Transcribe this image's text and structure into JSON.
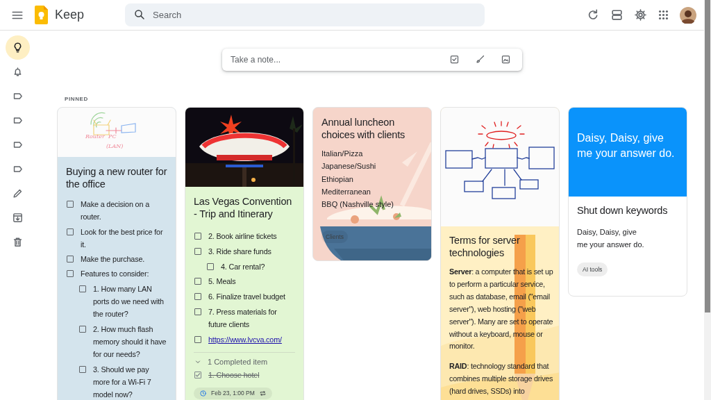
{
  "topbar": {
    "app_name": "Keep",
    "search": {
      "placeholder": "Search"
    }
  },
  "sidebar": [
    {
      "kind": "notes",
      "selected": true
    },
    {
      "kind": "reminders",
      "selected": false
    },
    {
      "kind": "label",
      "selected": false
    },
    {
      "kind": "label",
      "selected": false
    },
    {
      "kind": "label",
      "selected": false
    },
    {
      "kind": "label",
      "selected": false
    },
    {
      "kind": "edit",
      "selected": false
    },
    {
      "kind": "archive",
      "selected": false
    },
    {
      "kind": "trash",
      "selected": false
    }
  ],
  "new_note": {
    "placeholder": "Take a note..."
  },
  "section_title": "PINNED",
  "notes": [
    {
      "color": "#d4e4ed",
      "header": {
        "kind": "router-sketch",
        "labels": [
          "Router",
          "PC",
          "(LAN)"
        ]
      },
      "title": "Buying a new router for the office",
      "kind": "checklist",
      "items": [
        {
          "text": "Make a decision on a router.",
          "checked": false
        },
        {
          "text": "Look for the best price for it.",
          "checked": false
        },
        {
          "text": "Make the purchase.",
          "checked": false
        },
        {
          "text": "Features to consider:",
          "checked": false,
          "children": [
            {
              "text": "1. How many LAN ports do we need with the router?",
              "checked": false
            },
            {
              "text": "2. How much flash memory should it have for our needs?",
              "checked": false
            },
            {
              "text": "3. Should we pay more for a Wi-Fi 7 model now?",
              "checked": false
            }
          ]
        }
      ]
    },
    {
      "color": "#e2f6d3",
      "title": "Las Vegas Convention - Trip and Itinerary",
      "kind": "checklist",
      "items": [
        {
          "text": "2. Book airline tickets",
          "checked": false
        },
        {
          "text": "3. Ride share funds",
          "checked": false,
          "children": [
            {
              "text": "4. Car rental?",
              "checked": false
            }
          ]
        },
        {
          "text": "5. Meals",
          "checked": false
        },
        {
          "text": "6. Finalize travel budget",
          "checked": false
        },
        {
          "text": "7. Press materials for future clients",
          "checked": false
        },
        {
          "text": "https://www.lvcva.com/",
          "checked": false,
          "kind": "link"
        }
      ],
      "completed": {
        "label": "1 Completed item",
        "expanded": true,
        "items": [
          {
            "text": "1. Choose hotel",
            "checked": true
          }
        ]
      },
      "reminder": "Feb 23, 1:00 PM"
    },
    {
      "color": "#f6d5ca",
      "background": {
        "kind": "food"
      },
      "title": "Annual luncheon choices with clients",
      "kind": "text",
      "lines": [
        "Italian/Pizza",
        "Japanese/Sushi",
        "Ethiopian",
        "Mediterranean",
        "BBQ (Nashville style)"
      ],
      "label": "Clients"
    },
    {
      "color": "#fff0c4",
      "background": {
        "kind": "pencil"
      },
      "header": {
        "kind": "diagram-sketch"
      },
      "title": "Terms for server technologies",
      "kind": "text",
      "paragraphs": [
        "**Server**: a computer that is set up to perform a particular service, such as database, email (\"email server\"), web hosting (\"web server\"). Many are set to operate without a keyboard, mouse or monitor.",
        "**RAID**: technology standard that combines multiple storage drives (hard drives, SSDs) into"
      ]
    },
    {
      "color": "#ffffff",
      "header": {
        "kind": "banner",
        "text": "Daisy, Daisy, give me your answer do."
      },
      "title": "Shut down keywords",
      "kind": "text",
      "lines": [
        "Daisy, Daisy, give",
        "me your answer do."
      ],
      "label": "AI tools"
    }
  ]
}
